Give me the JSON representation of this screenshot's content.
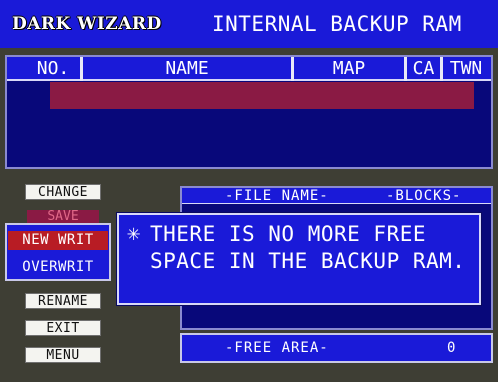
{
  "header": {
    "logo": "DARK WIZARD",
    "title": "INTERNAL BACKUP RAM"
  },
  "file_list": {
    "columns": [
      "NO.",
      "NAME",
      "MAP",
      "CA",
      "TWN"
    ],
    "rows": [
      {
        "no": "",
        "name": "",
        "map": "",
        "ca": "",
        "twn": ""
      }
    ]
  },
  "menu": {
    "change": "CHANGE",
    "save": "SAVE",
    "new_write": "NEW WRIT",
    "overwrite": "OVERWRIT",
    "rename": "RENAME",
    "exit": "EXIT",
    "menu": "MENU"
  },
  "file_panel": {
    "file_name_label": "-FILE NAME-",
    "blocks_label": "-BLOCKS-"
  },
  "free_area": {
    "label": "-FREE AREA-",
    "value": "0"
  },
  "dialog": {
    "bullet": "✳",
    "line1": "THERE IS NO MORE FREE",
    "line2": "SPACE IN THE BACKUP RAM."
  },
  "colors": {
    "panel_blue": "#1a1ad8",
    "panel_dark": "#08087a",
    "selection": "#8a1a44",
    "active_red": "#b81c24",
    "background": "#3e3e34"
  }
}
